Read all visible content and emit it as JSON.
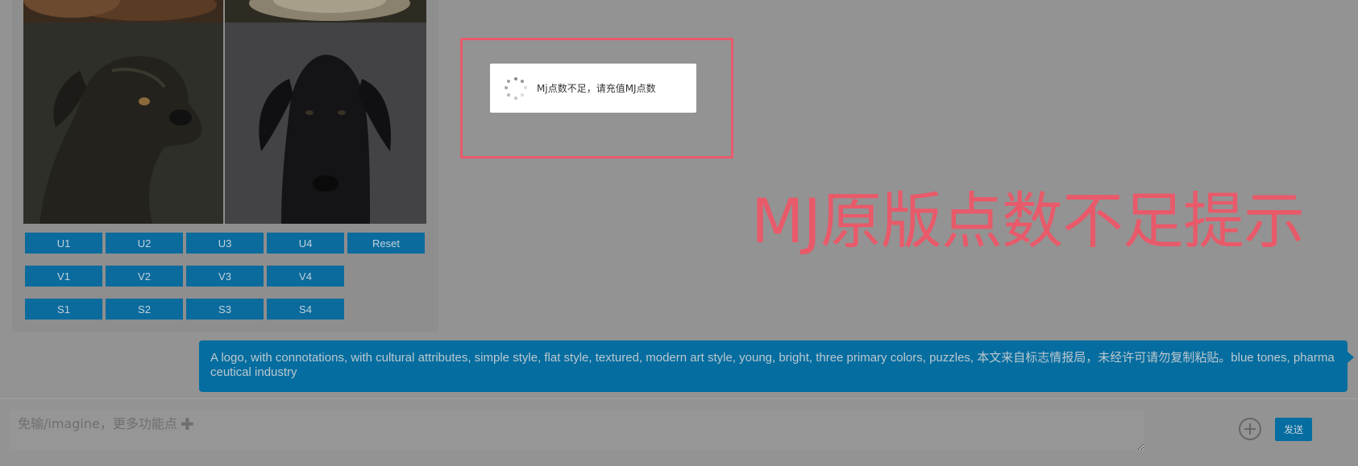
{
  "result_card": {
    "buttons_row1": [
      "U1",
      "U2",
      "U3",
      "U4",
      "Reset"
    ],
    "buttons_row2": [
      "V1",
      "V2",
      "V3",
      "V4"
    ],
    "buttons_row3": [
      "S1",
      "S2",
      "S3",
      "S4"
    ]
  },
  "toast": {
    "message": "Mj点数不足，请充值MJ点数"
  },
  "annotation": {
    "text": "MJ原版点数不足提示",
    "color": "#e85a6a"
  },
  "prompt_bubble": {
    "text": "A logo, with connotations, with cultural attributes, simple style, flat style, textured, modern art style, young, bright, three primary colors, puzzles, 本文来自标志情报局，未经许可请勿复制粘贴。blue tones, pharmaceutical industry"
  },
  "composer": {
    "placeholder": "免输/imagine，更多功能点",
    "plus_hint": "✚",
    "send_label": "发送"
  },
  "colors": {
    "accent": "#056d9f",
    "button": "#0b6b9d",
    "overlay_bg": "#939393"
  }
}
